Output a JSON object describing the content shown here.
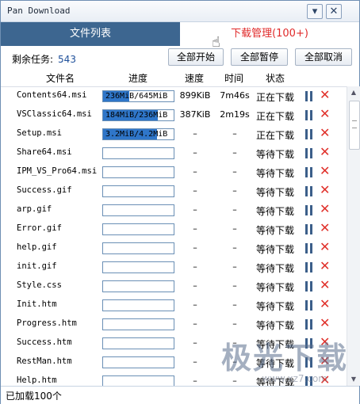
{
  "window": {
    "title": "Pan Download"
  },
  "titlebar_buttons": {
    "menu": "▾",
    "close": "✕"
  },
  "tabs": [
    {
      "label": "文件列表"
    },
    {
      "label": "下载管理(100+)"
    }
  ],
  "toolbar": {
    "remaining_label": "剩余任务:",
    "remaining_count": "543",
    "start_all": "全部开始",
    "pause_all": "全部暂停",
    "cancel_all": "全部取消"
  },
  "columns": {
    "name": "文件名",
    "progress": "进度",
    "speed": "速度",
    "time": "时间",
    "status": "状态"
  },
  "rows": [
    {
      "name": "Contents64.msi",
      "progress_text": "236MiB/645MiB",
      "progress": 0.366,
      "speed": "899KiB",
      "time": "7m46s",
      "status": "正在下载"
    },
    {
      "name": "VSClassic64.msi",
      "progress_text": "184MiB/236MiB",
      "progress": 0.78,
      "speed": "387KiB",
      "time": "2m19s",
      "status": "正在下载"
    },
    {
      "name": "Setup.msi",
      "progress_text": "3.2MiB/4.2MiB",
      "progress": 0.76,
      "speed": "–",
      "time": "–",
      "status": "正在下载"
    },
    {
      "name": "Share64.msi",
      "progress_text": "",
      "progress": 0,
      "speed": "–",
      "time": "–",
      "status": "等待下载"
    },
    {
      "name": "IPM_VS_Pro64.msi",
      "progress_text": "",
      "progress": 0,
      "speed": "–",
      "time": "–",
      "status": "等待下载"
    },
    {
      "name": "Success.gif",
      "progress_text": "",
      "progress": 0,
      "speed": "–",
      "time": "–",
      "status": "等待下载"
    },
    {
      "name": "arp.gif",
      "progress_text": "",
      "progress": 0,
      "speed": "–",
      "time": "–",
      "status": "等待下载"
    },
    {
      "name": "Error.gif",
      "progress_text": "",
      "progress": 0,
      "speed": "–",
      "time": "–",
      "status": "等待下载"
    },
    {
      "name": "help.gif",
      "progress_text": "",
      "progress": 0,
      "speed": "–",
      "time": "–",
      "status": "等待下载"
    },
    {
      "name": "init.gif",
      "progress_text": "",
      "progress": 0,
      "speed": "–",
      "time": "–",
      "status": "等待下载"
    },
    {
      "name": "Style.css",
      "progress_text": "",
      "progress": 0,
      "speed": "–",
      "time": "–",
      "status": "等待下载"
    },
    {
      "name": "Init.htm",
      "progress_text": "",
      "progress": 0,
      "speed": "–",
      "time": "–",
      "status": "等待下载"
    },
    {
      "name": "Progress.htm",
      "progress_text": "",
      "progress": 0,
      "speed": "–",
      "time": "–",
      "status": "等待下载"
    },
    {
      "name": "Success.htm",
      "progress_text": "",
      "progress": 0,
      "speed": "–",
      "time": "–",
      "status": "等待下载"
    },
    {
      "name": "RestMan.htm",
      "progress_text": "",
      "progress": 0,
      "speed": "–",
      "time": "–",
      "status": "等待下载"
    },
    {
      "name": "Help.htm",
      "progress_text": "",
      "progress": 0,
      "speed": "–",
      "time": "–",
      "status": "等待下载"
    }
  ],
  "statusbar": {
    "loaded": "已加载100个"
  },
  "watermark": {
    "text": "极光下载",
    "url": "www.xz7.com"
  },
  "colors": {
    "tab_active_bg": "#3d6690",
    "tab_highlight": "#e02a2a",
    "progress_fill": "#2f76c9",
    "close_red": "#e0302a"
  }
}
